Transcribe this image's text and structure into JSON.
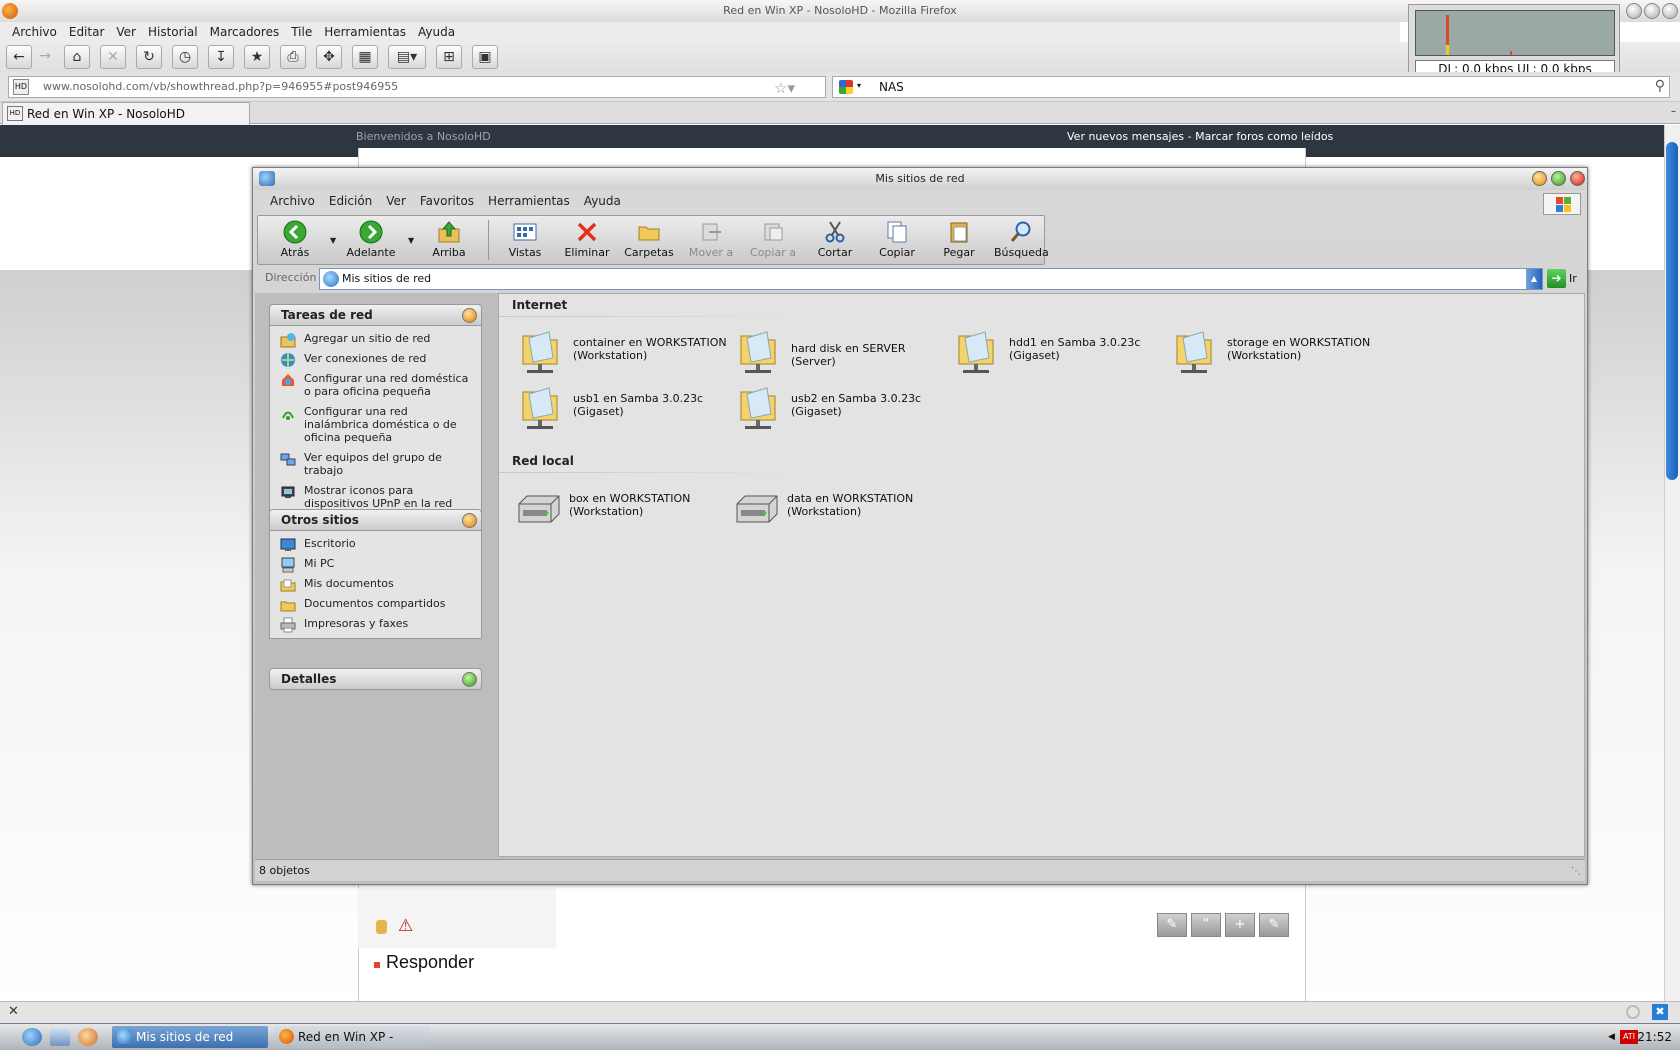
{
  "firefox": {
    "window_title": "Red en Win XP - NosoloHD - Mozilla Firefox",
    "menu": [
      "Archivo",
      "Editar",
      "Ver",
      "Historial",
      "Marcadores",
      "Tile",
      "Herramientas",
      "Ayuda"
    ],
    "url_icon": "HD",
    "url": "www.nosolohd.com/vb/showthread.php?p=946955#post946955",
    "search_value": "NAS",
    "tab_title": "Red en Win XP - NosoloHD",
    "net_monitor": "DL: 0,0 kbps   UL: 0,0 kbps"
  },
  "webpage": {
    "welcome": "Bienvenidos a NosoloHD",
    "links": "Ver nuevos mensajes - Marcar foros como leídos",
    "reply": "Responder"
  },
  "explorer": {
    "title": "Mis sitios de red",
    "menu": [
      "Archivo",
      "Edición",
      "Ver",
      "Favoritos",
      "Herramientas",
      "Ayuda"
    ],
    "toolbar": {
      "back": "Atrás",
      "forward": "Adelante",
      "up": "Arriba",
      "views": "Vistas",
      "delete": "Eliminar",
      "folders": "Carpetas",
      "move": "Mover a",
      "copy_to": "Copiar a",
      "cut": "Cortar",
      "copy": "Copiar",
      "paste": "Pegar",
      "search": "Búsqueda"
    },
    "address_label": "Dirección",
    "address_value": "Mis sitios de red",
    "go_label": "Ir",
    "panels": {
      "network_tasks": {
        "title": "Tareas de red",
        "items": [
          "Agregar un sitio de red",
          "Ver conexiones de red",
          "Configurar una red doméstica o para oficina pequeña",
          "Configurar una red inalámbrica doméstica o de oficina pequeña",
          "Ver equipos del grupo de trabajo",
          "Mostrar iconos para dispositivos UPnP en la red"
        ]
      },
      "other_places": {
        "title": "Otros sitios",
        "items": [
          "Escritorio",
          "Mi PC",
          "Mis documentos",
          "Documentos compartidos",
          "Impresoras y faxes"
        ]
      },
      "details": {
        "title": "Detalles"
      }
    },
    "groups": {
      "internet": {
        "title": "Internet",
        "items": [
          "container en WORKSTATION (Workstation)",
          "hard disk en SERVER (Server)",
          "hdd1 en Samba 3.0.23c (Gigaset)",
          "storage en WORKSTATION (Workstation)",
          "usb1 en Samba 3.0.23c (Gigaset)",
          "usb2 en Samba 3.0.23c (Gigaset)"
        ]
      },
      "local": {
        "title": "Red local",
        "items": [
          "box en WORKSTATION (Workstation)",
          "data en WORKSTATION (Workstation)"
        ]
      }
    },
    "status": "8 objetos"
  },
  "taskbar": {
    "tasks": [
      "Mis sitios de red",
      "Red en Win XP - Nosol..."
    ],
    "tray_badge": "ATI",
    "clock": "21:52"
  }
}
